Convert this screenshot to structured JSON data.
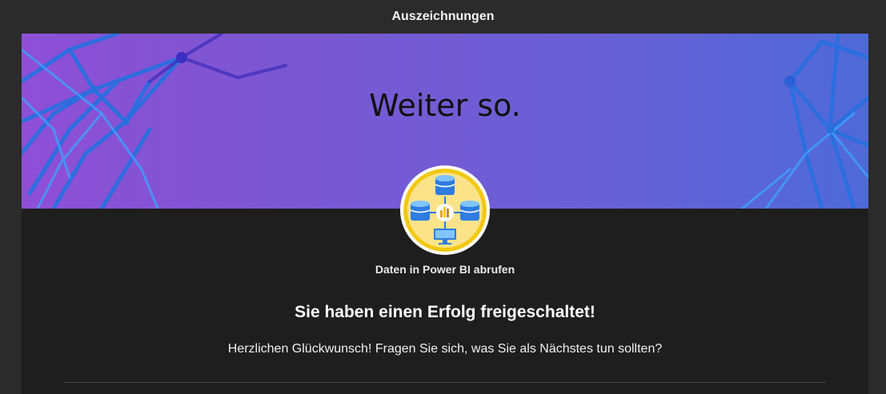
{
  "dialog": {
    "title": "Auszeichnungen"
  },
  "hero": {
    "title": "Weiter so."
  },
  "badge": {
    "name": "Daten in Power BI abrufen",
    "icon": "data-sources-badge-icon",
    "ring_color": "#f2c811",
    "fill_color": "#fbe38a"
  },
  "achievement": {
    "headline": "Sie haben einen Erfolg freigeschaltet!",
    "message": "Herzlichen Glückwunsch! Fragen Sie sich, was Sie als Nächstes tun sollten?"
  },
  "colors": {
    "background": "#2b2b2b",
    "panel": "#1e1e1e",
    "hero_start": "#8e4fd6",
    "hero_end": "#4f6ad8"
  }
}
